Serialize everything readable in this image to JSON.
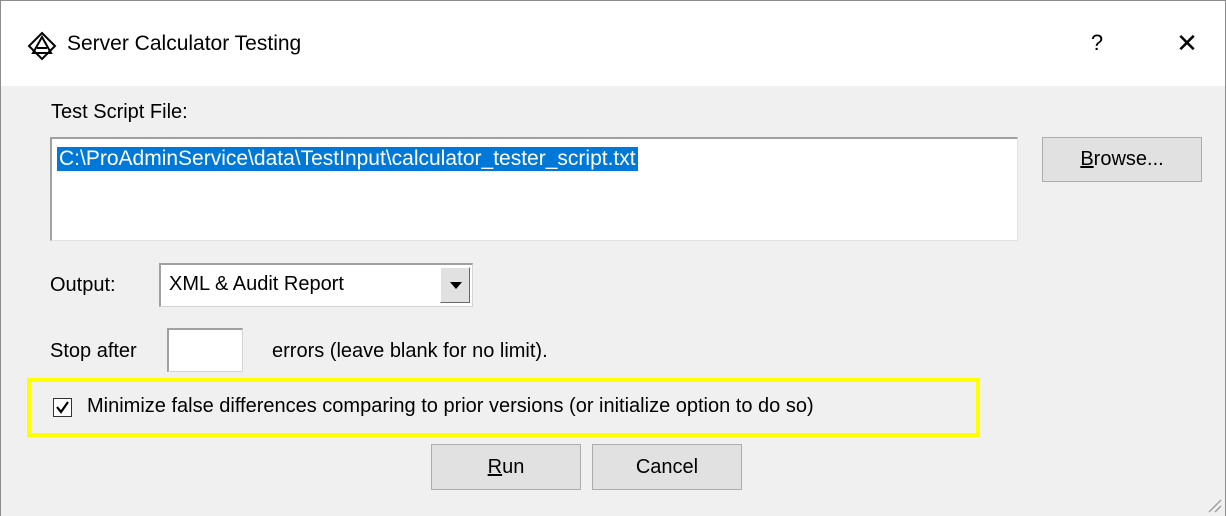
{
  "window": {
    "title": "Server Calculator Testing",
    "help_label": "?",
    "close_label": "✕",
    "app_icon": "ade-logo-icon"
  },
  "script_file": {
    "label": "Test Script File:",
    "value": "C:\\ProAdminService\\data\\TestInput\\calculator_tester_script.txt",
    "browse_label_mnemonic": "B",
    "browse_label_rest": "rowse..."
  },
  "output": {
    "label": "Output:",
    "selected": "XML & Audit Report"
  },
  "stop_after": {
    "label": "Stop after",
    "value": "",
    "suffix": "errors (leave blank for no limit)."
  },
  "minimize": {
    "checked": true,
    "label": "Minimize false differences comparing to prior versions (or initialize option to do so)"
  },
  "buttons": {
    "run_mnemonic": "R",
    "run_rest": "un",
    "cancel": "Cancel"
  },
  "colors": {
    "highlight": "#ffff00",
    "selection": "#0078d7"
  }
}
